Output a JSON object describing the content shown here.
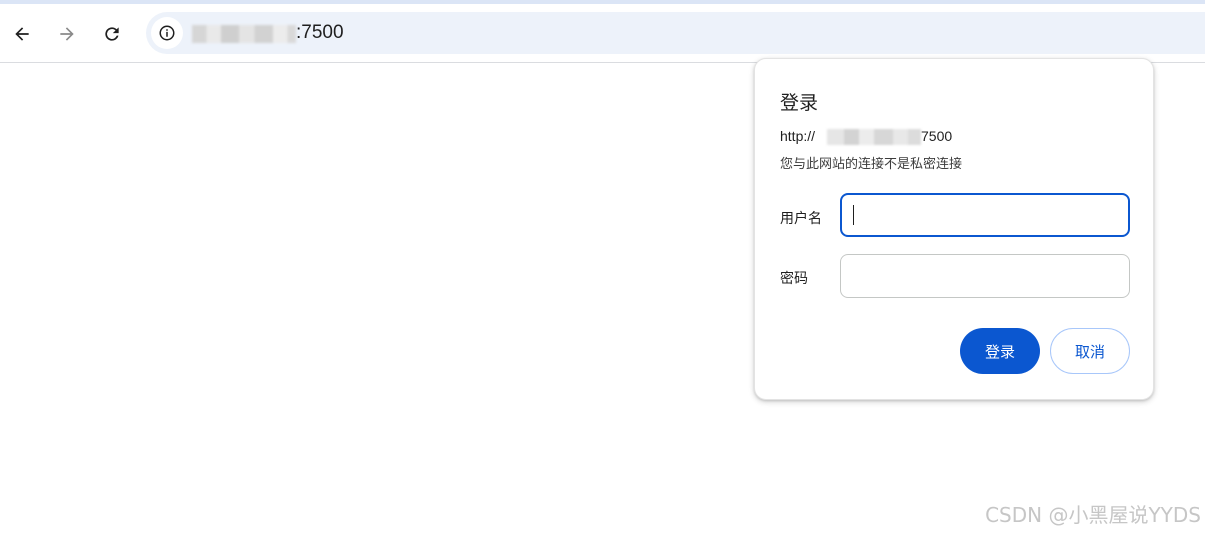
{
  "toolbar": {
    "back_icon": "arrow-left-icon",
    "forward_icon": "arrow-right-icon",
    "reload_icon": "reload-icon",
    "site_info_icon": "info-icon",
    "url_visible": ":7500"
  },
  "auth_dialog": {
    "title": "登录",
    "origin_prefix": "http://",
    "origin_port": "7500",
    "warning": "您与此网站的连接不是私密连接",
    "username_label": "用户名",
    "username_value": "",
    "password_label": "密码",
    "password_value": "",
    "login_button": "登录",
    "cancel_button": "取消"
  },
  "watermark": "CSDN @小黑屋说YYDS",
  "colors": {
    "accent": "#0b57d0",
    "omnibox_bg": "#edf2fa"
  }
}
